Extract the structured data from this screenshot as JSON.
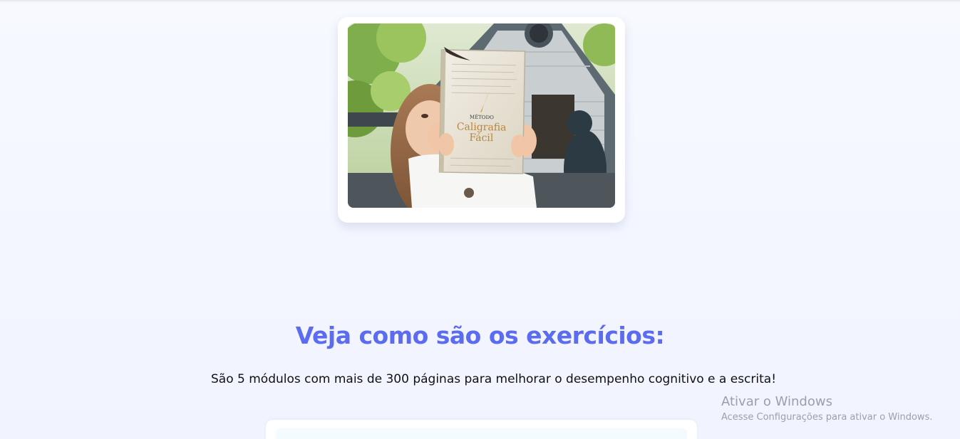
{
  "hero": {
    "book_label_small": "MÉTODO",
    "book_title_line1": "Caligrafia",
    "book_title_line2": "Fácil"
  },
  "section": {
    "title": "Veja como são os exercícios:",
    "subtitle": "São 5 módulos com mais de 300 páginas para melhorar o desempenho cognitivo e a escrita!"
  },
  "windows_watermark": {
    "title": "Ativar o Windows",
    "subtitle": "Acesse Configurações para ativar o Windows."
  },
  "colors": {
    "accent": "#5b6cf0",
    "background": "#f3f6ff",
    "text": "#111111",
    "book_gold": "#b8863a"
  }
}
